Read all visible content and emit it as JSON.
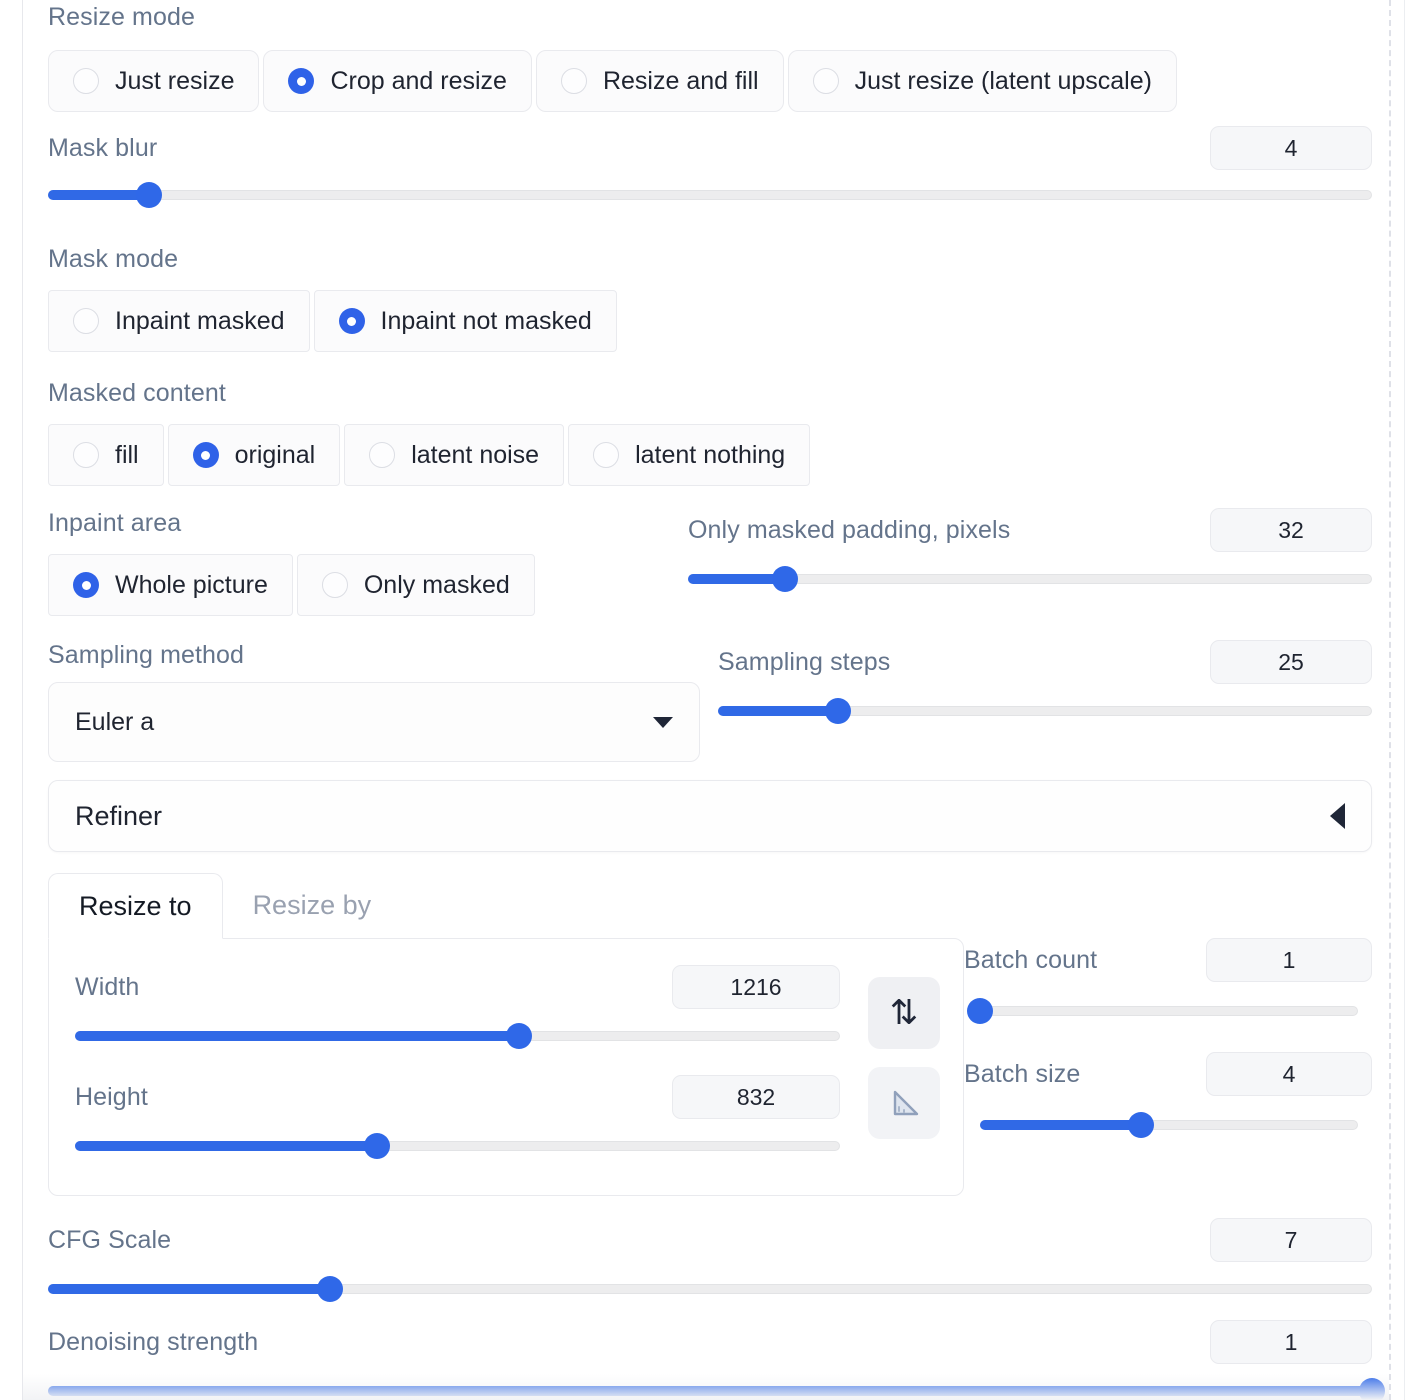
{
  "resize_mode": {
    "label": "Resize mode",
    "options": [
      {
        "label": "Just resize",
        "selected": false
      },
      {
        "label": "Crop and resize",
        "selected": true
      },
      {
        "label": "Resize and fill",
        "selected": false
      },
      {
        "label": "Just resize (latent upscale)",
        "selected": false
      }
    ]
  },
  "mask_blur": {
    "label": "Mask blur",
    "value": "4",
    "percent": 7.6
  },
  "mask_mode": {
    "label": "Mask mode",
    "options": [
      {
        "label": "Inpaint masked",
        "selected": false
      },
      {
        "label": "Inpaint not masked",
        "selected": true
      }
    ]
  },
  "masked_content": {
    "label": "Masked content",
    "options": [
      {
        "label": "fill",
        "selected": false
      },
      {
        "label": "original",
        "selected": true
      },
      {
        "label": "latent noise",
        "selected": false
      },
      {
        "label": "latent nothing",
        "selected": false
      }
    ]
  },
  "inpaint_area": {
    "label": "Inpaint area",
    "options": [
      {
        "label": "Whole picture",
        "selected": true
      },
      {
        "label": "Only masked",
        "selected": false
      }
    ]
  },
  "only_masked_padding": {
    "label": "Only masked padding, pixels",
    "value": "32",
    "percent": 14.2
  },
  "sampling_method": {
    "label": "Sampling method",
    "value": "Euler a",
    "caret": "chevron-down-icon"
  },
  "sampling_steps": {
    "label": "Sampling steps",
    "value": "25",
    "percent": 18.3
  },
  "refiner": {
    "title": "Refiner",
    "caret": "chevron-left-icon"
  },
  "resize_tabs": [
    {
      "label": "Resize to",
      "active": true
    },
    {
      "label": "Resize by",
      "active": false
    }
  ],
  "width": {
    "label": "Width",
    "value": "1216",
    "percent": 58.0
  },
  "height": {
    "label": "Height",
    "value": "832",
    "percent": 39.5
  },
  "swap_button": {
    "icon": "swap-vertical-icon",
    "glyph": "⇅"
  },
  "ratio_button": {
    "icon": "triangle-ruler-icon"
  },
  "batch_count": {
    "label": "Batch count",
    "value": "1",
    "percent": 0
  },
  "batch_size": {
    "label": "Batch size",
    "value": "4",
    "percent": 42.5
  },
  "cfg_scale": {
    "label": "CFG Scale",
    "value": "7",
    "percent": 21.3
  },
  "denoising_strength": {
    "label": "Denoising strength",
    "value": "1",
    "percent": 100
  },
  "colors": {
    "accent_blue": "#2f62e8",
    "slider_track": "#ededee",
    "label_gray": "#64748b",
    "text_dark": "#1f2430"
  }
}
